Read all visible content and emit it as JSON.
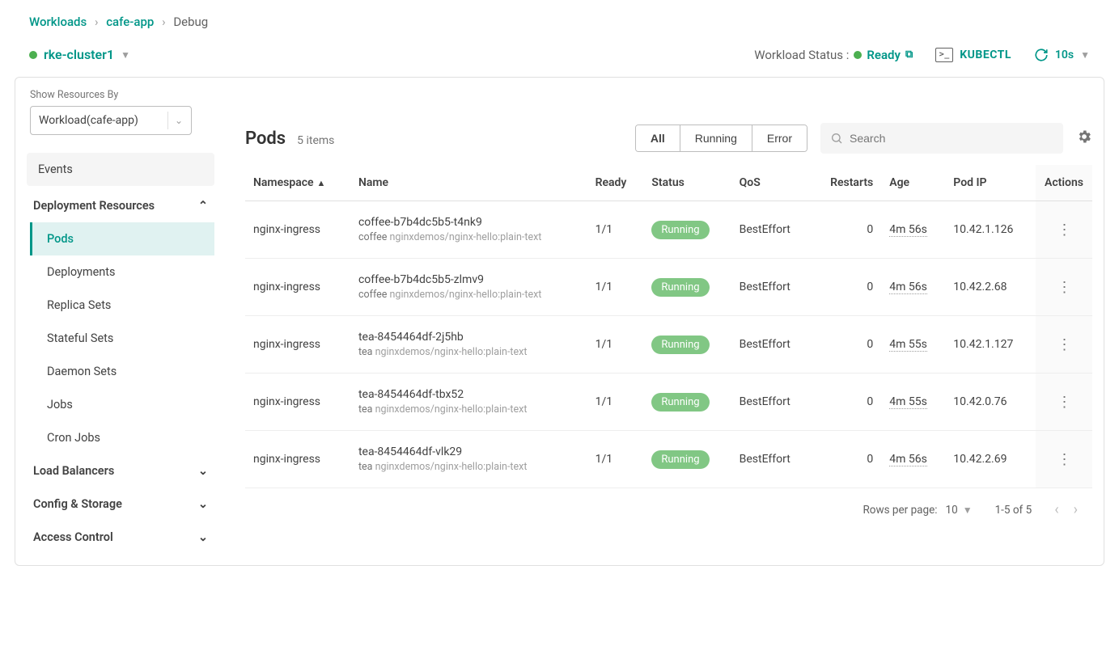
{
  "breadcrumb": {
    "root": "Workloads",
    "app": "cafe-app",
    "current": "Debug"
  },
  "cluster": {
    "name": "rke-cluster1"
  },
  "workload_status": {
    "label": "Workload Status :",
    "value": "Ready"
  },
  "kubectl_label": "KUBECTL",
  "refresh": {
    "interval": "10s"
  },
  "filter": {
    "label": "Show Resources By",
    "value": "Workload(cafe-app)"
  },
  "sidebar": {
    "events": "Events",
    "deployment_resources": "Deployment Resources",
    "items": {
      "pods": "Pods",
      "deployments": "Deployments",
      "replica_sets": "Replica Sets",
      "stateful_sets": "Stateful Sets",
      "daemon_sets": "Daemon Sets",
      "jobs": "Jobs",
      "cron_jobs": "Cron Jobs"
    },
    "load_balancers": "Load Balancers",
    "config_storage": "Config & Storage",
    "access_control": "Access Control"
  },
  "pods_header": {
    "title": "Pods",
    "count": "5 items"
  },
  "filters": {
    "all": "All",
    "running": "Running",
    "error": "Error"
  },
  "search_placeholder": "Search",
  "columns": {
    "namespace": "Namespace",
    "name": "Name",
    "ready": "Ready",
    "status": "Status",
    "qos": "QoS",
    "restarts": "Restarts",
    "age": "Age",
    "pod_ip": "Pod IP",
    "actions": "Actions"
  },
  "rows": [
    {
      "namespace": "nginx-ingress",
      "name": "coffee-b7b4dc5b5-t4nk9",
      "container": "coffee",
      "image": "nginxdemos/nginx-hello:plain-text",
      "ready": "1/1",
      "status": "Running",
      "qos": "BestEffort",
      "restarts": "0",
      "age": "4m 56s",
      "ip": "10.42.1.126"
    },
    {
      "namespace": "nginx-ingress",
      "name": "coffee-b7b4dc5b5-zlmv9",
      "container": "coffee",
      "image": "nginxdemos/nginx-hello:plain-text",
      "ready": "1/1",
      "status": "Running",
      "qos": "BestEffort",
      "restarts": "0",
      "age": "4m 56s",
      "ip": "10.42.2.68"
    },
    {
      "namespace": "nginx-ingress",
      "name": "tea-8454464df-2j5hb",
      "container": "tea",
      "image": "nginxdemos/nginx-hello:plain-text",
      "ready": "1/1",
      "status": "Running",
      "qos": "BestEffort",
      "restarts": "0",
      "age": "4m 55s",
      "ip": "10.42.1.127"
    },
    {
      "namespace": "nginx-ingress",
      "name": "tea-8454464df-tbx52",
      "container": "tea",
      "image": "nginxdemos/nginx-hello:plain-text",
      "ready": "1/1",
      "status": "Running",
      "qos": "BestEffort",
      "restarts": "0",
      "age": "4m 55s",
      "ip": "10.42.0.76"
    },
    {
      "namespace": "nginx-ingress",
      "name": "tea-8454464df-vlk29",
      "container": "tea",
      "image": "nginxdemos/nginx-hello:plain-text",
      "ready": "1/1",
      "status": "Running",
      "qos": "BestEffort",
      "restarts": "0",
      "age": "4m 56s",
      "ip": "10.42.2.69"
    }
  ],
  "pagination": {
    "rows_per_page_label": "Rows per page:",
    "rows_per_page": "10",
    "range": "1-5 of 5"
  }
}
